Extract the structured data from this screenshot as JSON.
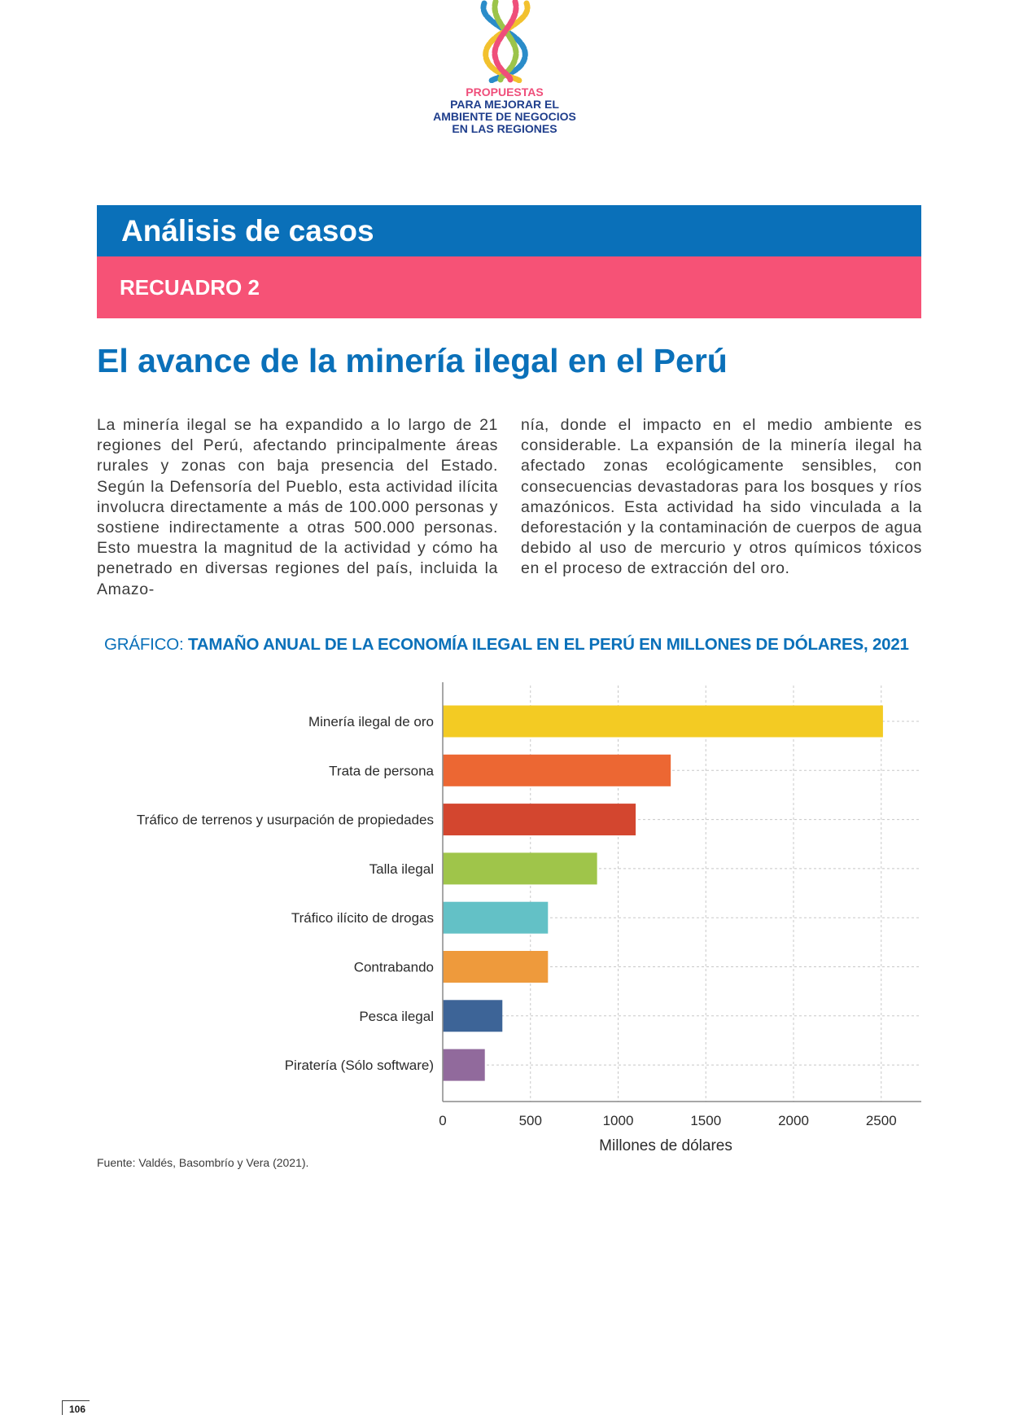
{
  "header": {
    "logo_lines": [
      "PROPUESTAS",
      "PARA MEJORAR EL",
      "AMBIENTE DE NEGOCIOS",
      "EN LAS REGIONES"
    ]
  },
  "banner": {
    "section": "Análisis de casos",
    "box": "RECUADRO 2"
  },
  "article": {
    "title": "El avance de la minería ilegal en el Perú",
    "col_left": "La minería ilegal se ha expandido a lo largo de 21 regiones del Perú, afectando principalmente áreas rurales y zonas con baja presencia del Estado. Según la Defensoría del Pueblo, esta actividad ilícita involucra directamente a más de 100.000 personas y sostiene indirectamente a otras 500.000 personas. Esto muestra la magnitud de la actividad y cómo ha penetrado en diversas regiones del país, incluida la Amazo-",
    "col_right": "nía, donde el impacto en el medio ambiente es considerable. La expansión de la minería ilegal ha afectado zonas ecológicamente sensibles, con consecuencias devastadoras para los bosques y ríos amazónicos. Esta actividad ha sido vinculada a la deforestación y la contaminación de cuerpos de agua debido al uso de mercurio y otros químicos tóxicos en el proceso de extracción del oro."
  },
  "chart_title": {
    "prefix": "GRÁFICO: ",
    "main": "TAMAÑO ANUAL DE LA ECONOMÍA ILEGAL EN EL PERÚ EN MILLONES DE DÓLARES, 2021"
  },
  "chart_data": {
    "type": "bar",
    "orientation": "horizontal",
    "categories": [
      "Minería ilegal de oro",
      "Trata de persona",
      "Tráfico de terrenos  y usurpación de propiedades",
      "Talla ilegal",
      "Tráfico ilícito de drogas",
      "Contrabando",
      "Pesca ilegal",
      "Piratería (Sólo software)"
    ],
    "values": [
      2510,
      1300,
      1100,
      880,
      600,
      600,
      340,
      240
    ],
    "colors": [
      "#f3cb23",
      "#ec6733",
      "#d3462f",
      "#9fc54a",
      "#63c1c6",
      "#ee9a3c",
      "#3d6497",
      "#916a9c"
    ],
    "xlabel": "Millones de dólares",
    "ylabel": "",
    "xticks": [
      "0",
      "500",
      "1000",
      "1500",
      "2000",
      "2500"
    ],
    "xlim": [
      0,
      2720
    ],
    "grid": true
  },
  "source": "Fuente: Valdés, Basombrío y Vera (2021).",
  "page_number": "106"
}
